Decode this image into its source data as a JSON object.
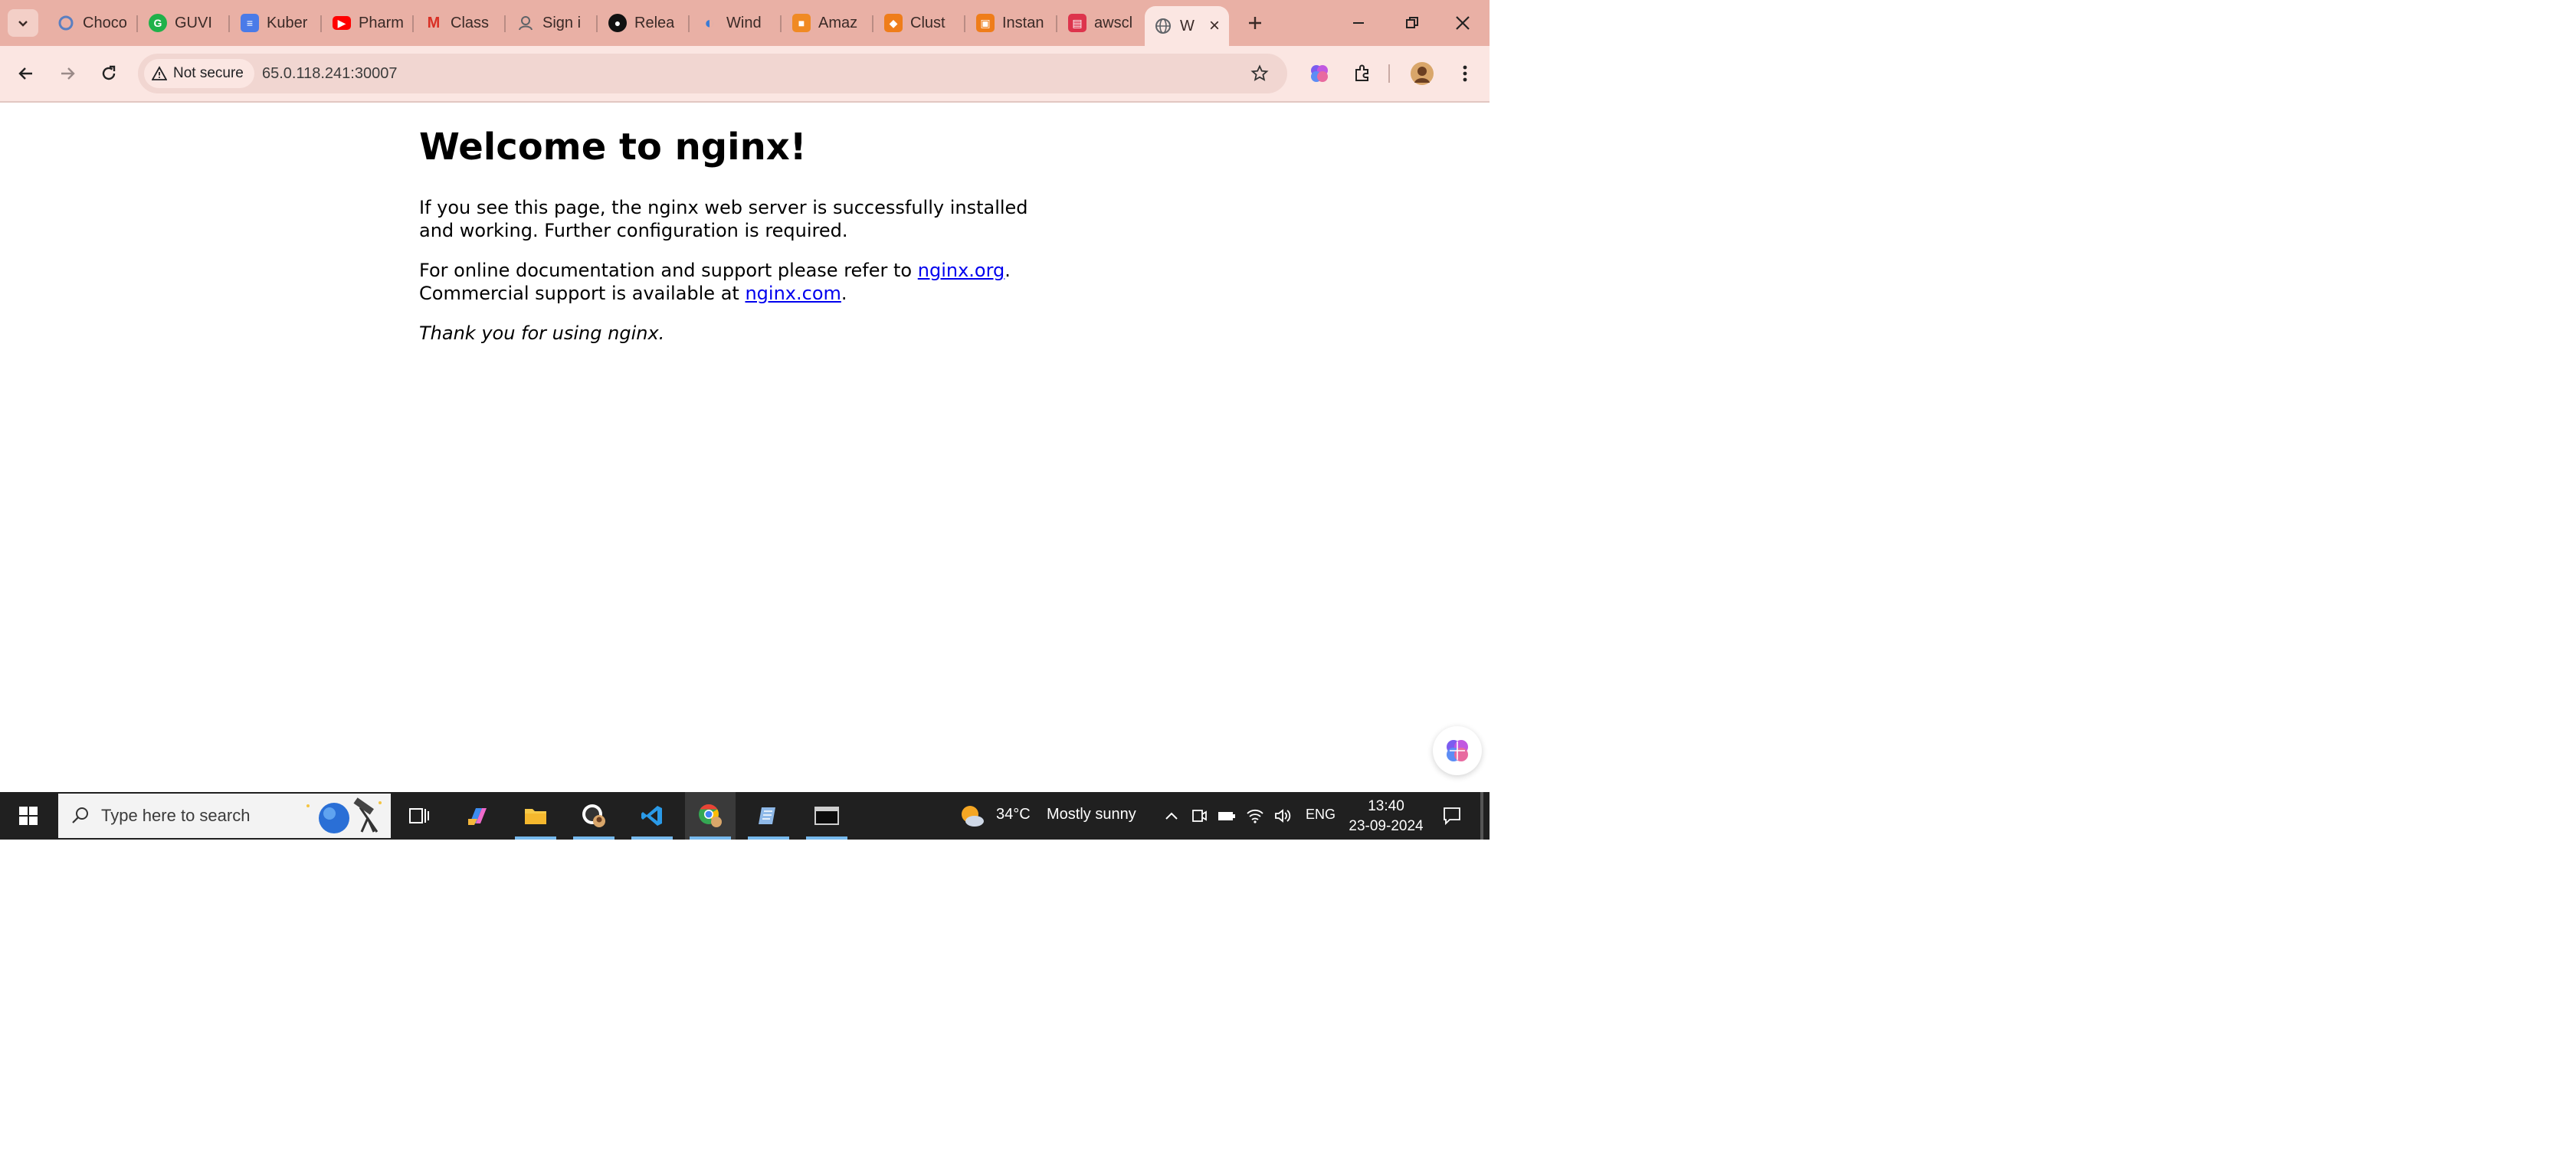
{
  "browser": {
    "tabs": [
      {
        "title": "Choco",
        "icon": "chocolatey-icon",
        "color": "#5a7fc1"
      },
      {
        "title": "GUVI",
        "icon": "guvi-icon",
        "color": "#1fb14a"
      },
      {
        "title": "Kuber",
        "icon": "docs-icon",
        "color": "#4a7be8"
      },
      {
        "title": "Pharm",
        "icon": "youtube-icon",
        "color": "#ff0000"
      },
      {
        "title": "Class",
        "icon": "gmail-icon",
        "color": "#d93025"
      },
      {
        "title": "Sign i",
        "icon": "person-icon",
        "color": "#5f6368"
      },
      {
        "title": "Relea",
        "icon": "github-icon",
        "color": "#111111"
      },
      {
        "title": "Wind",
        "icon": "bird-icon",
        "color": "#3a7bd5"
      },
      {
        "title": "Amaz",
        "icon": "aws-cube-icon",
        "color": "#f08a24"
      },
      {
        "title": "Clust",
        "icon": "aws-eks-icon",
        "color": "#ef7d1a"
      },
      {
        "title": "Instan",
        "icon": "aws-ec2-icon",
        "color": "#ef7d1a"
      },
      {
        "title": "awscl",
        "icon": "aws-cli-icon",
        "color": "#dd344c"
      },
      {
        "title": "W",
        "icon": "globe-icon",
        "color": "#5f6368",
        "active": true
      }
    ],
    "security_label": "Not secure",
    "url": "65.0.118.241:30007"
  },
  "page": {
    "heading": "Welcome to nginx!",
    "para1": "If you see this page, the nginx web server is successfully installed and working. Further configuration is required.",
    "para2_prefix": "For online documentation and support please refer to",
    "link_org": "nginx.org",
    "para2_mid": "Commercial support is available at",
    "link_com": "nginx.com",
    "thanks": "Thank you for using nginx."
  },
  "taskbar": {
    "search_placeholder": "Type here to search",
    "weather_temp": "34°C",
    "weather_text": "Mostly sunny",
    "language": "ENG",
    "time": "13:40",
    "date": "23-09-2024"
  },
  "colors": {
    "tabstrip": "#e9b0a5",
    "toolbar": "#fbe6e2",
    "taskbar": "#202020",
    "link": "#0000ee"
  }
}
